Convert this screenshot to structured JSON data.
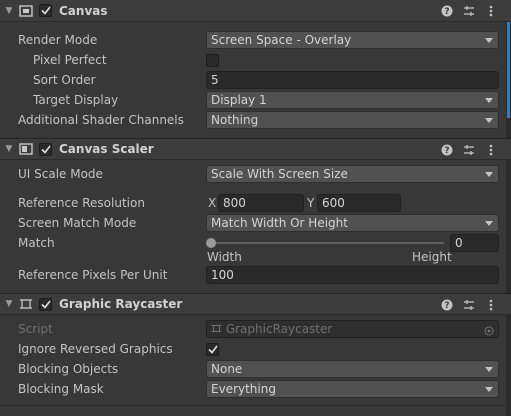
{
  "canvas": {
    "title": "Canvas",
    "enabled": true,
    "render_mode": {
      "label": "Render Mode",
      "value": "Screen Space - Overlay"
    },
    "pixel_perfect": {
      "label": "Pixel Perfect",
      "checked": false
    },
    "sort_order": {
      "label": "Sort Order",
      "value": "5"
    },
    "target_display": {
      "label": "Target Display",
      "value": "Display 1"
    },
    "additional_shader_channels": {
      "label": "Additional Shader Channels",
      "value": "Nothing"
    }
  },
  "canvas_scaler": {
    "title": "Canvas Scaler",
    "enabled": true,
    "ui_scale_mode": {
      "label": "UI Scale Mode",
      "value": "Scale With Screen Size"
    },
    "reference_resolution": {
      "label": "Reference Resolution",
      "x_label": "X",
      "x": "800",
      "y_label": "Y",
      "y": "600"
    },
    "screen_match_mode": {
      "label": "Screen Match Mode",
      "value": "Match Width Or Height"
    },
    "match": {
      "label": "Match",
      "value": "0",
      "left_label": "Width",
      "right_label": "Height"
    },
    "reference_pixels_per_unit": {
      "label": "Reference Pixels Per Unit",
      "value": "100"
    }
  },
  "graphic_raycaster": {
    "title": "Graphic Raycaster",
    "enabled": true,
    "script": {
      "label": "Script",
      "value": "GraphicRaycaster"
    },
    "ignore_reversed_graphics": {
      "label": "Ignore Reversed Graphics",
      "checked": true
    },
    "blocking_objects": {
      "label": "Blocking Objects",
      "value": "None"
    },
    "blocking_mask": {
      "label": "Blocking Mask",
      "value": "Everything"
    }
  },
  "icons": {
    "fold": "fold-arrow-icon",
    "help": "help-icon",
    "presets": "presets-icon",
    "menu": "kebab-menu-icon"
  },
  "colors": {
    "panel_bg": "#383838",
    "header_bg": "#3c3c3c",
    "field_bg": "#2a2a2a",
    "dropdown_bg": "#515151",
    "accent_blue": "#3a79bb"
  }
}
